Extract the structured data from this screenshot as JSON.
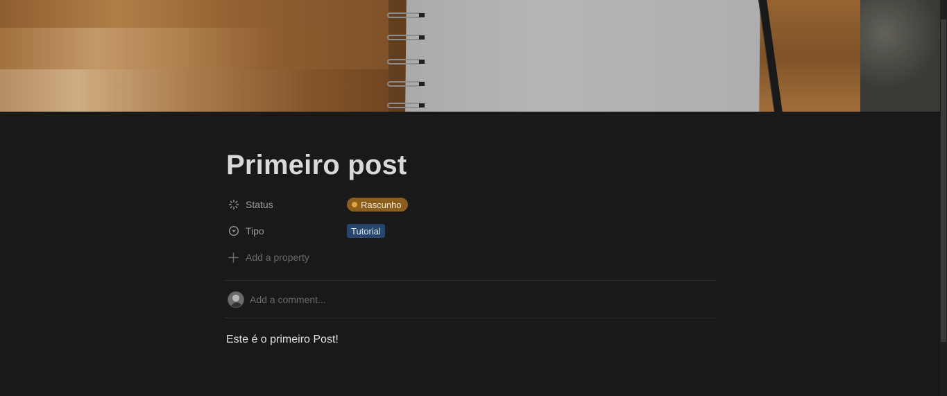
{
  "page": {
    "title": "Primeiro post",
    "body": "Este é o primeiro Post!"
  },
  "properties": [
    {
      "name": "Status",
      "icon": "status-loading-icon",
      "value": "Rascunho",
      "color": "#8a5f1e"
    },
    {
      "name": "Tipo",
      "icon": "select-chevron-icon",
      "value": "Tutorial",
      "color": "#28456c"
    }
  ],
  "add_property": {
    "label": "Add a property",
    "icon": "plus-icon"
  },
  "comment": {
    "placeholder": "Add a comment..."
  },
  "cover": {
    "description": "wooden-desk-notebook-cover"
  }
}
